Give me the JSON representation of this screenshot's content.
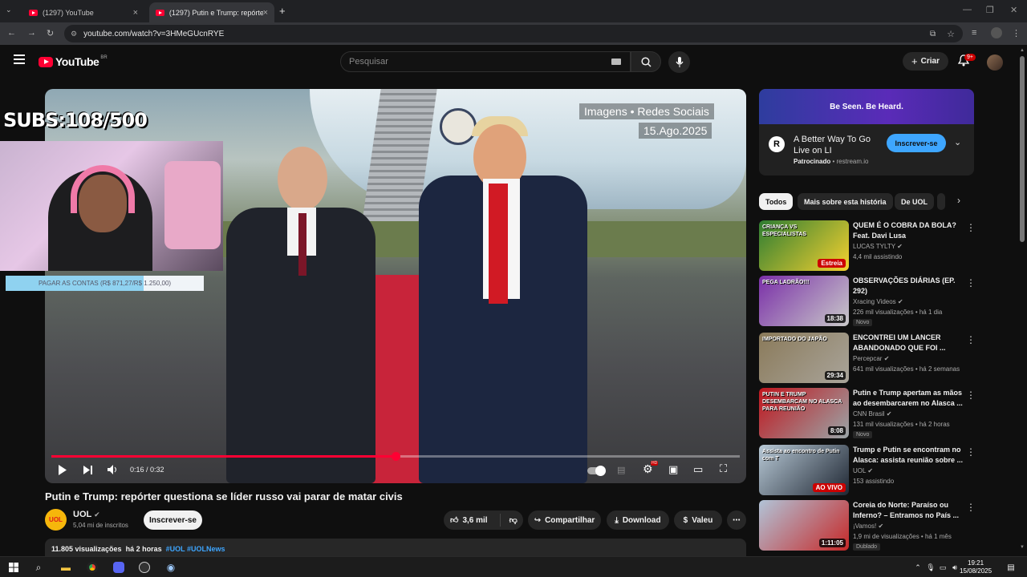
{
  "browser": {
    "tabs": [
      {
        "label": "(1297) YouTube"
      },
      {
        "label": "(1297) Putin e Trump: repórter q…"
      }
    ],
    "new_tab": "+",
    "url": "youtube.com/watch?v=3HMeGUcnRYE"
  },
  "header": {
    "logo_text": "YouTube",
    "country_code": "BR",
    "search_placeholder": "Pesquisar",
    "create_label": "Criar",
    "notifications_badge": "9+"
  },
  "player": {
    "overlay_line1": "Imagens • Redes Sociais",
    "overlay_line2": "15.Ago.2025",
    "subs_counter": "SUBS:108/500",
    "goal_text": "PAGAR AS CONTAS (R$ 871,27/R$ 1.250,00)",
    "goal_fraction": 0.697,
    "progress_fraction": 0.5,
    "time_current": "0:16",
    "time_total": "0:32",
    "timecode": "0:16 / 0:32"
  },
  "video": {
    "title": "Putin e Trump: repórter questiona se líder russo vai parar de matar civis",
    "channel_name": "UOL",
    "channel_logo_text": "UOL",
    "subscribers": "5,04 mi de inscritos",
    "subscribe_label": "Inscrever-se",
    "likes": "3,6 mil",
    "share_label": "Compartilhar",
    "download_label": "Download",
    "thanks_label": "Valeu",
    "views": "11.805 visualizações",
    "posted": "há 2 horas",
    "tags": "#UOL #UOLNews"
  },
  "ad": {
    "banner": "Be Seen. Be Heard.",
    "logo_letter": "R",
    "title": "A Better Way To Go Live on LI",
    "sponsored": "Patrocinado",
    "domain": "restream.io",
    "subscribe_label": "Inscrever-se"
  },
  "chips": [
    "Todos",
    "Mais sobre esta história",
    "De UOL"
  ],
  "recommendations": [
    {
      "title": "QUEM É O COBRA DA BOLA? Feat. Davi Lusa",
      "channel": "LUCAS TYLTY",
      "stats": "4,4 mil assistindo",
      "badge": "Estreia",
      "thumb_text": "CRIANÇA VS ESPECIALISTAS",
      "colors": [
        "#2e7d32",
        "#f5d130"
      ]
    },
    {
      "title": "OBSERVAÇÕES DIÁRIAS (EP. 292)",
      "channel": "Xracing Videos",
      "stats": "226 mil visualizações • há 1 dia",
      "duration": "18:38",
      "tag": "Novo",
      "thumb_text": "PEGA LADRÃO!!!",
      "colors": [
        "#7a2fa8",
        "#c9c9c9"
      ]
    },
    {
      "title": "ENCONTREI UM LANCER ABANDONADO QUE FOI ...",
      "channel": "Percepcar",
      "stats": "641 mil visualizações • há 2 semanas",
      "duration": "29:34",
      "thumb_text": "IMPORTADO DO JAPÃO",
      "colors": [
        "#8a7a5a",
        "#a9a49a"
      ]
    },
    {
      "title": "Putin e Trump apertam as mãos ao desembarcarem no Alasca ...",
      "channel": "CNN Brasil",
      "stats": "131 mil visualizações • há 2 horas",
      "duration": "8:08",
      "tag": "Novo",
      "thumb_text": "PUTIN E TRUMP DESEMBARCAM NO ALASCA PARA REUNIÃO",
      "colors": [
        "#c0151d",
        "#9aa6a8"
      ]
    },
    {
      "title": "Trump e Putin se encontram no Alasca: assista reunião sobre ...",
      "channel": "UOL",
      "stats": "153 assistindo",
      "live": "AO VIVO",
      "thumb_text": "Assista ao encontro de Putin com T",
      "colors": [
        "#b8c9d6",
        "#1f2733"
      ]
    },
    {
      "title": "Coreia do Norte: Paraíso ou Inferno? – Entramos no País ...",
      "channel": "¡Vamos!",
      "stats": "1,9 mi de visualizações • há 1 mês",
      "duration": "1:11:05",
      "tag": "Dublado",
      "colors": [
        "#b1c4d8",
        "#c62828"
      ]
    }
  ],
  "taskbar": {
    "time": "19:21",
    "date": "15/08/2025"
  }
}
